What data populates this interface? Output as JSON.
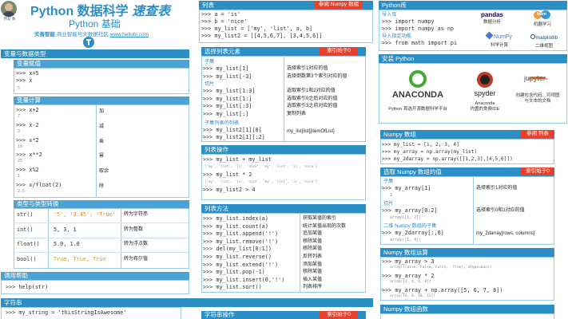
{
  "header": {
    "title_main": "Python 数据科学",
    "title_em": "速查表",
    "subtitle": "Python 基础",
    "org_brand": "天善智能",
    "org_rest": "商业智能与大数据社区",
    "url": "www.hellobi.com",
    "avatar_label": "用友·数"
  },
  "variables": {
    "title": "变量与数据类型",
    "assign_title": "变量赋值",
    "assign_code": ">>> x=5\n>>> x",
    "assign_out": "5",
    "calc_title": "变量计算",
    "calc_rows": [
      {
        "code": ">>> x+2",
        "out": "7",
        "desc": "加"
      },
      {
        "code": ">>> x-2",
        "out": "3",
        "desc": "减"
      },
      {
        "code": ">>> x*2",
        "out": "10",
        "desc": "乘"
      },
      {
        "code": ">>> x**2",
        "out": "25",
        "desc": "幂"
      },
      {
        "code": ">>> x%2",
        "out": "1",
        "desc": "取余"
      },
      {
        "code": ">>> x/float(2)",
        "out": "2.5",
        "desc": "除"
      }
    ],
    "types_title": "类型与类型转换",
    "types_rows": [
      {
        "fn": "str()",
        "vals": "'5', '3.45', 'True'",
        "desc": "转为字符串"
      },
      {
        "fn": "int()",
        "vals": "5, 3, 1",
        "desc": "转为整数"
      },
      {
        "fn": "float()",
        "vals": "5.0, 1.0",
        "desc": "转为浮点数"
      },
      {
        "fn": "bool()",
        "vals": "True, True, True",
        "desc": "转为布尔值"
      }
    ],
    "help_title": "调用帮助",
    "help_code": ">>> help(str)"
  },
  "strings": {
    "title": "字符串",
    "code": ">>> my_string = 'thisStringIsAwesome'"
  },
  "lists": {
    "title": "列表",
    "badge": "参阅 Numpy 数组",
    "code": ">>> a = 'is'\n>>> b = 'nice'\n>>> my_list = ['my', 'list', a, b]\n>>> my_list2 = [[4,5,6,7], [3,4,5,6]]",
    "select_title": "选择列表元素",
    "select_badge": "索引始于0",
    "subset_label": "子集",
    "subset_rows": [
      {
        "code": ">>> my_list[1]",
        "desc": "选择索引1对应的值"
      },
      {
        "code": ">>> my_list[-3]",
        "desc": "选择倒数第3个索引对应的值"
      }
    ],
    "slice_label": "切片",
    "slice_rows": [
      {
        "code": ">>> my_list[1:3]",
        "desc": "选取索引1和2对应的值"
      },
      {
        "code": ">>> my_list[1:]",
        "desc": "选取索引0之后对应的值"
      },
      {
        "code": ">>> my_list[:3]",
        "desc": "选取索引3之前对应的值"
      },
      {
        "code": ">>> my_list[:]",
        "desc": "复制列表"
      }
    ],
    "sublist_label": "子集列表的列表",
    "sublist_code": ">>> my_list2[1][0]\n>>> my_list2[1][:2]",
    "sublist_desc": "my_list[list][itemOfList]",
    "ops_title": "列表操作",
    "ops_rows": [
      {
        "code": ">>> my_list + my_list",
        "out": "['my', 'list', 'is', 'nice', 'my', 'list', 'is', 'nice']"
      },
      {
        "code": ">>> my_list * 2",
        "out": "['my', 'list', 'is', 'nice', 'my', 'list', 'is', 'nice']"
      },
      {
        "code": ">>> my_list2 > 4",
        "out": ""
      }
    ],
    "methods_title": "列表方法",
    "methods_rows": [
      {
        "code": ">>> my_list.index(a)",
        "desc": "获取某值的索引"
      },
      {
        "code": ">>> my_list.count(a)",
        "desc": "统计某值出现的次数"
      },
      {
        "code": ">>> my_list.append('!')",
        "desc": "追加某值"
      },
      {
        "code": ">>> my_list.remove('!')",
        "desc": "移除某值"
      },
      {
        "code": ">>> del(my_list[0:1])",
        "desc": "移除某值"
      },
      {
        "code": ">>> my_list.reverse()",
        "desc": "反转列表"
      },
      {
        "code": ">>> my_list.extend('!')",
        "desc": "添加某值"
      },
      {
        "code": ">>> my_list.pop(-1)",
        "desc": "移除某值"
      },
      {
        "code": ">>> my_list.insert(0,'!')",
        "desc": "插入某值"
      },
      {
        "code": ">>> my_list.sort()",
        "desc": "列表排序"
      }
    ],
    "strops_title": "字符串操作",
    "strops_badge": "索引始于0"
  },
  "libs": {
    "title": "Python库",
    "import_label": "导入库",
    "import_code": ">>> import numpy\n>>> import numpy as np",
    "import_spec_label": "导入指定功能",
    "import_spec_code": ">>> from math import pi",
    "logos": [
      {
        "name": "pandas",
        "caption": "数据分析"
      },
      {
        "name": "learn",
        "caption": "机器学习"
      },
      {
        "name": "NumPy",
        "caption": "科学计算"
      },
      {
        "name": "matplotlib",
        "caption": "二维视图"
      }
    ]
  },
  "install": {
    "title": "安装 Python",
    "items": [
      {
        "name": "ANACONDA",
        "caption": "Python 首选开源数据科学平台",
        "color": "#44a833"
      },
      {
        "name": "spyder",
        "caption": "Anaconda\n内置的免费IDE",
        "color": "#c0392b"
      },
      {
        "name": "jupyter",
        "caption": "创建包含代码、可视图\n与文本的文档",
        "color": "#f37726"
      }
    ]
  },
  "numpy": {
    "title": "Numpy 数组",
    "badge": "参阅 列表",
    "code": ">>> my_list = [1, 2, 3, 4]\n>>> my_array = np.array(my_list)\n>>> my_2darray = np.array([[1,2,3],[4,5,6]])",
    "select_title": "选取 Numpy 数组的值",
    "select_badge": "索引始于0",
    "subset_label": "子集",
    "subset_code": ">>> my_array[1]",
    "subset_out": "2",
    "subset_desc": "选择索引1对应的值",
    "slice_label": "切片",
    "slice_code": ">>> my_array[0:2]",
    "slice_out": "array([1, 2])",
    "slice_desc": "选择索引0和1对应的值",
    "sub2d_label": "二维 Numpy 数组的子集",
    "sub2d_code": ">>> my_2darray[:,0]",
    "sub2d_out": "array([1, 4])",
    "sub2d_desc": "my_2darray[rows, columns]",
    "ops_title": "Numpy 数组运算",
    "ops_rows": [
      {
        "code": ">>> my_array > 3",
        "out": "array([False, False, False,  True], dtype=bool)"
      },
      {
        "code": ">>> my_array * 2",
        "out": "array([2, 4, 6, 8])"
      },
      {
        "code": ">>> my_array + np.array([5, 6, 7, 8])",
        "out": "array([6, 8, 10, 12])"
      }
    ],
    "funcs_title": "Numpy 数组函数"
  },
  "colors": {
    "header_blue": "#2b8ec5",
    "badge_red": "#e7412d",
    "title_blue": "#2b8ec5",
    "border": "#9ccbe6"
  }
}
